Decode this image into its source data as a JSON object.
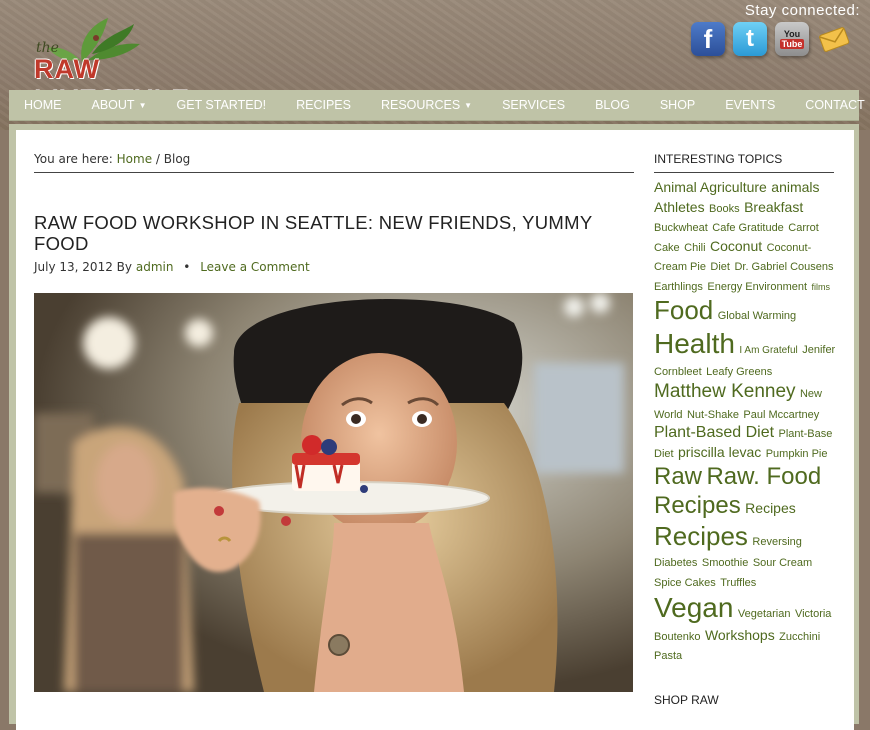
{
  "header": {
    "logo": {
      "the": "the",
      "raw": "RAW",
      "livestyle": "LIVESTYLE"
    },
    "stay_connected": "Stay connected:",
    "social": [
      {
        "name": "facebook",
        "glyph": "f"
      },
      {
        "name": "twitter",
        "glyph": "t"
      },
      {
        "name": "youtube",
        "you": "You",
        "tube": "Tube"
      },
      {
        "name": "email",
        "icon": "envelope-icon"
      }
    ]
  },
  "nav": [
    {
      "label": "HOME",
      "has_caret": false
    },
    {
      "label": "ABOUT",
      "has_caret": true
    },
    {
      "label": "GET STARTED!",
      "has_caret": false
    },
    {
      "label": "RECIPES",
      "has_caret": false
    },
    {
      "label": "RESOURCES",
      "has_caret": true
    },
    {
      "label": "SERVICES",
      "has_caret": false
    },
    {
      "label": "BLOG",
      "has_caret": false
    },
    {
      "label": "SHOP",
      "has_caret": false
    },
    {
      "label": "EVENTS",
      "has_caret": false
    },
    {
      "label": "CONTACT",
      "has_caret": false
    }
  ],
  "breadcrumb": {
    "prefix": "You are here:",
    "home": "Home",
    "sep": " / ",
    "current": "Blog"
  },
  "post": {
    "title": "RAW FOOD WORKSHOP IN SEATTLE: NEW FRIENDS, YUMMY FOOD",
    "date": "July 13, 2012",
    "by": "By",
    "author": "admin",
    "comment_link": "Leave a Comment"
  },
  "sidebar": {
    "topics_heading": "INTERESTING TOPICS",
    "tags": [
      {
        "t": "Animal Agriculture",
        "s": 14
      },
      {
        "t": "animals",
        "s": 14
      },
      {
        "t": "Athletes",
        "s": 14
      },
      {
        "t": "Books",
        "s": 11
      },
      {
        "t": "Breakfast",
        "s": 14
      },
      {
        "t": "Buckwheat",
        "s": 11
      },
      {
        "t": "Cafe Gratitude",
        "s": 11
      },
      {
        "t": "Carrot Cake",
        "s": 11
      },
      {
        "t": "Chili",
        "s": 11
      },
      {
        "t": "Coconut",
        "s": 14
      },
      {
        "t": "Coconut-Cream Pie",
        "s": 11
      },
      {
        "t": "Diet",
        "s": 11
      },
      {
        "t": "Dr. Gabriel Cousens",
        "s": 11
      },
      {
        "t": "Earthlings",
        "s": 11
      },
      {
        "t": "Energy Environment",
        "s": 11
      },
      {
        "t": "films",
        "s": 9
      },
      {
        "t": "Food",
        "s": 26
      },
      {
        "t": "Global Warming",
        "s": 11
      },
      {
        "t": "Health",
        "s": 28
      },
      {
        "t": "I Am Grateful",
        "s": 10
      },
      {
        "t": "Jenifer Cornbleet",
        "s": 11
      },
      {
        "t": "Leafy Greens",
        "s": 11
      },
      {
        "t": "Matthew Kenney",
        "s": 19
      },
      {
        "t": "New World",
        "s": 11
      },
      {
        "t": "Nut-Shake",
        "s": 11
      },
      {
        "t": "Paul Mccartney",
        "s": 11
      },
      {
        "t": "Plant-Based Diet",
        "s": 16
      },
      {
        "t": "Plant-Base Diet",
        "s": 11
      },
      {
        "t": "priscilla levac",
        "s": 14
      },
      {
        "t": "Pumpkin Pie",
        "s": 11
      },
      {
        "t": "Raw",
        "s": 24
      },
      {
        "t": "Raw. Food Recipes",
        "s": 24
      },
      {
        "t": "Recipes",
        "s": 14
      },
      {
        "t": "Recipes",
        "s": 26
      },
      {
        "t": "Reversing Diabetes",
        "s": 11
      },
      {
        "t": "Smoothie",
        "s": 11
      },
      {
        "t": "Sour Cream",
        "s": 11
      },
      {
        "t": "Spice Cakes",
        "s": 11
      },
      {
        "t": "Truffles",
        "s": 11
      },
      {
        "t": "Vegan",
        "s": 28
      },
      {
        "t": "Vegetarian",
        "s": 11
      },
      {
        "t": "Victoria Boutenko",
        "s": 11
      },
      {
        "t": "Workshops",
        "s": 14
      },
      {
        "t": "Zucchini Pasta",
        "s": 11
      }
    ],
    "shop_heading": "SHOP RAW"
  },
  "colors": {
    "accent": "#4f6a1f",
    "nav_bg": "#bfc3a7",
    "header_bg": "#8e7d6d"
  }
}
